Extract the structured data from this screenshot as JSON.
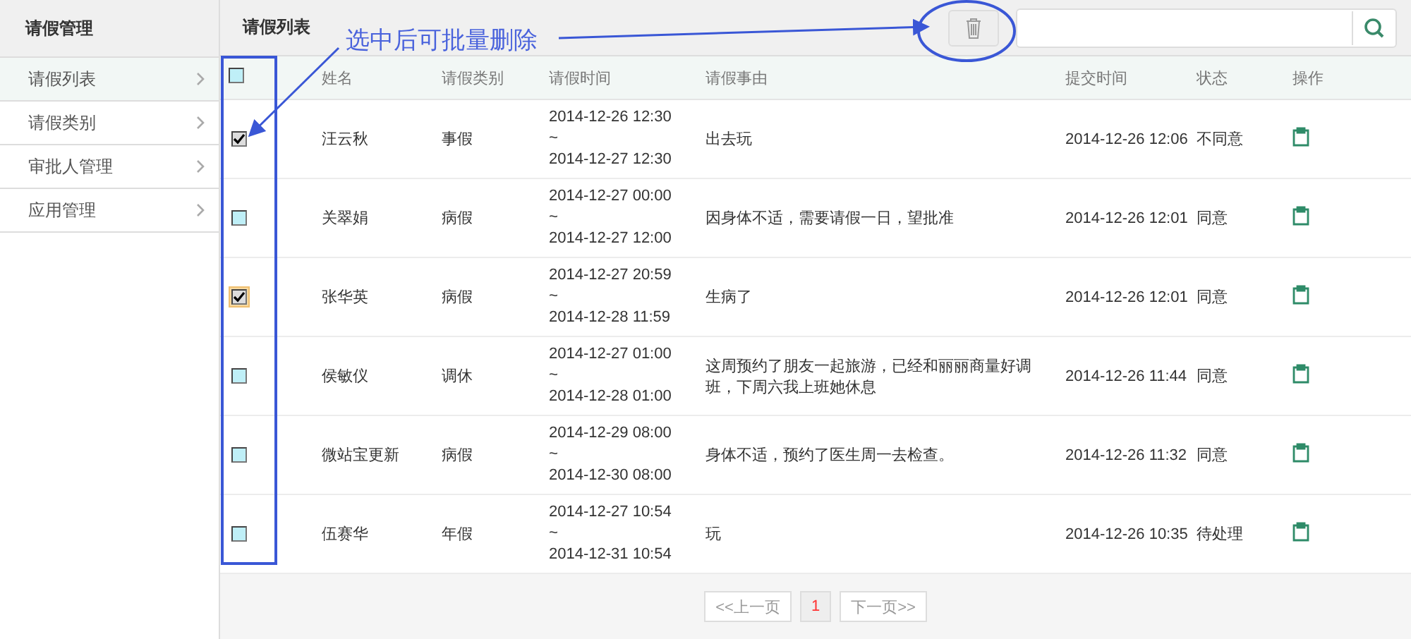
{
  "sidebar": {
    "title": "请假管理",
    "items": [
      {
        "label": "请假列表",
        "selected": true
      },
      {
        "label": "请假类别",
        "selected": false
      },
      {
        "label": "审批人管理",
        "selected": false
      },
      {
        "label": "应用管理",
        "selected": false
      }
    ]
  },
  "toolbar": {
    "title": "请假列表"
  },
  "table": {
    "columns": [
      "姓名",
      "请假类别",
      "请假时间",
      "请假事由",
      "提交时间",
      "状态",
      "操作"
    ],
    "header_checked": false,
    "rows": [
      {
        "checked": true,
        "focused": false,
        "name": "汪云秋",
        "type": "事假",
        "start": "2014-12-26 12:30",
        "sep": "~",
        "end": "2014-12-27 12:30",
        "reason": "出去玩",
        "submitted": "2014-12-26 12:06",
        "status": "不同意"
      },
      {
        "checked": false,
        "focused": false,
        "name": "关翠娟",
        "type": "病假",
        "start": "2014-12-27 00:00",
        "sep": "~",
        "end": "2014-12-27 12:00",
        "reason": "因身体不适，需要请假一日，望批准",
        "submitted": "2014-12-26 12:01",
        "status": "同意"
      },
      {
        "checked": true,
        "focused": true,
        "name": "张华英",
        "type": "病假",
        "start": "2014-12-27 20:59",
        "sep": "~",
        "end": "2014-12-28 11:59",
        "reason": "生病了",
        "submitted": "2014-12-26 12:01",
        "status": "同意"
      },
      {
        "checked": false,
        "focused": false,
        "name": "侯敏仪",
        "type": "调休",
        "start": "2014-12-27 01:00",
        "sep": "~",
        "end": "2014-12-28 01:00",
        "reason": "这周预约了朋友一起旅游，已经和丽丽商量好调班，下周六我上班她休息",
        "submitted": "2014-12-26 11:44",
        "status": "同意"
      },
      {
        "checked": false,
        "focused": false,
        "name": "微站宝更新",
        "type": "病假",
        "start": "2014-12-29 08:00",
        "sep": "~",
        "end": "2014-12-30 08:00",
        "reason": "身体不适，预约了医生周一去检查。",
        "submitted": "2014-12-26 11:32",
        "status": "同意"
      },
      {
        "checked": false,
        "focused": false,
        "name": "伍赛华",
        "type": "年假",
        "start": "2014-12-27 10:54",
        "sep": "~",
        "end": "2014-12-31 10:54",
        "reason": "玩",
        "submitted": "2014-12-26 10:35",
        "status": "待处理"
      }
    ]
  },
  "pagination": {
    "prev": "<<上一页",
    "pages": [
      {
        "label": "1",
        "selected": true
      }
    ],
    "next": "下一页>>"
  },
  "annotation": {
    "text": "选中后可批量删除"
  }
}
